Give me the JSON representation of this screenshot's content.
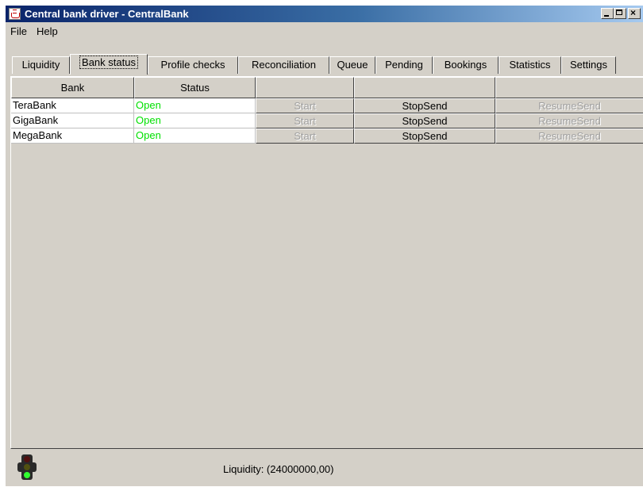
{
  "window": {
    "title": "Central bank driver - CentralBank",
    "controls": {
      "minimize": "_",
      "maximize": "□",
      "close": "×"
    }
  },
  "menu": {
    "items": [
      {
        "label": "File"
      },
      {
        "label": "Help"
      }
    ]
  },
  "tabs": {
    "selected": "Bank status",
    "items": [
      {
        "label": "Liquidity"
      },
      {
        "label": "Bank status"
      },
      {
        "label": "Profile checks"
      },
      {
        "label": "Reconciliation"
      },
      {
        "label": "Queue"
      },
      {
        "label": "Pending"
      },
      {
        "label": "Bookings"
      },
      {
        "label": "Statistics"
      },
      {
        "label": "Settings"
      }
    ]
  },
  "table": {
    "columns": [
      "Bank",
      "Status",
      "",
      "",
      ""
    ],
    "rows": [
      {
        "bank": "TeraBank",
        "status": "Open",
        "start": "Start",
        "stop": "StopSend",
        "resume": "ResumeSend"
      },
      {
        "bank": "GigaBank",
        "status": "Open",
        "start": "Start",
        "stop": "StopSend",
        "resume": "ResumeSend"
      },
      {
        "bank": "MegaBank",
        "status": "Open",
        "start": "Start",
        "stop": "StopSend",
        "resume": "ResumeSend"
      }
    ]
  },
  "status_bar": {
    "liquidity": "Liquidity: (24000000,00)",
    "indicator": "traffic-light-icon"
  },
  "colors": {
    "titlebar_start": "#0a246a",
    "titlebar_end": "#a6caf0",
    "status_open": "#00e000",
    "face": "#d4d0c8"
  }
}
